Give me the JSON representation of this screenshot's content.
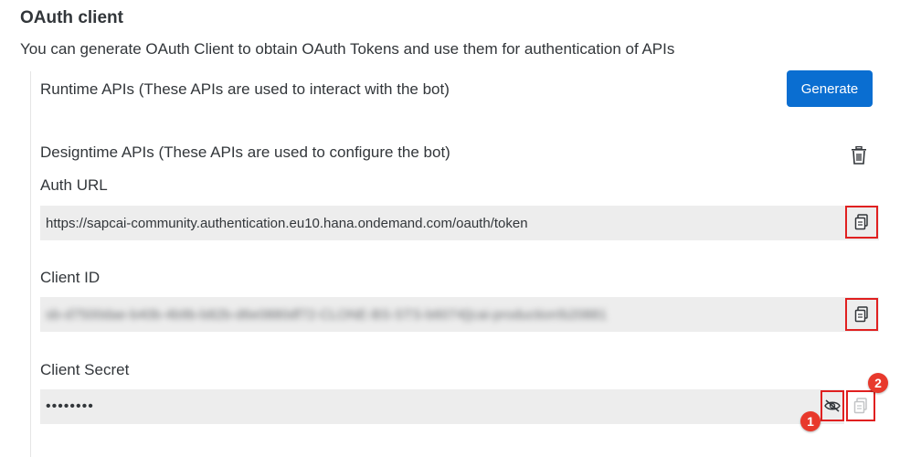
{
  "header": {
    "title": "OAuth client",
    "description": "You can generate OAuth Client to obtain OAuth Tokens and use them for authentication of APIs"
  },
  "runtime": {
    "label": "Runtime APIs (These APIs are used to interact with the bot)",
    "generate_label": "Generate"
  },
  "designtime": {
    "label": "Designtime APIs (These APIs are used to configure the bot)",
    "delete_icon": "trash-icon"
  },
  "auth_url": {
    "label": "Auth URL",
    "value": "https://sapcai-community.authentication.eu10.hana.ondemand.com/oauth/token",
    "copy_icon": "copy-icon"
  },
  "client_id": {
    "label": "Client ID",
    "value": "sb-d7500dae-b40b-4b9b-b82b-d6e0880df72-CLONE-BS-STS-b6074||cai-production!b20881",
    "copy_icon": "copy-icon"
  },
  "client_secret": {
    "label": "Client Secret",
    "value": "••••••••",
    "visibility_icon": "eye-slash-icon",
    "copy_icon": "copy-icon"
  },
  "annotations": {
    "badge_1": "1",
    "badge_2": "2",
    "highlight_color": "#e02020"
  },
  "colors": {
    "accent": "#0a6ed1",
    "field_bg": "#ededed",
    "text": "#32363a"
  }
}
